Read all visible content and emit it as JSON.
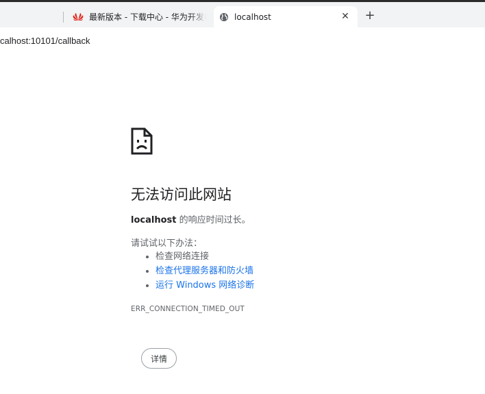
{
  "tabs": [
    {
      "title": "最新版本 - 下载中心 - 华为开发者联盟",
      "icon": "huawei-logo-icon",
      "active": false
    },
    {
      "title": "localhost",
      "icon": "globe-icon",
      "active": true
    }
  ],
  "new_tab_label": "+",
  "close_label": "✕",
  "url": "calhost:10101/callback",
  "error": {
    "title": "无法访问此网站",
    "host": "localhost",
    "message": " 的响应时间过长。",
    "try_label": "请试试以下办法：",
    "suggestions": [
      "检查网络连接",
      "检查代理服务器和防火墙",
      "运行 Windows 网络诊断"
    ],
    "code": "ERR_CONNECTION_TIMED_OUT",
    "details_button": "详情"
  },
  "colors": {
    "link": "#1a73e8",
    "huawei": "#e1251b"
  }
}
